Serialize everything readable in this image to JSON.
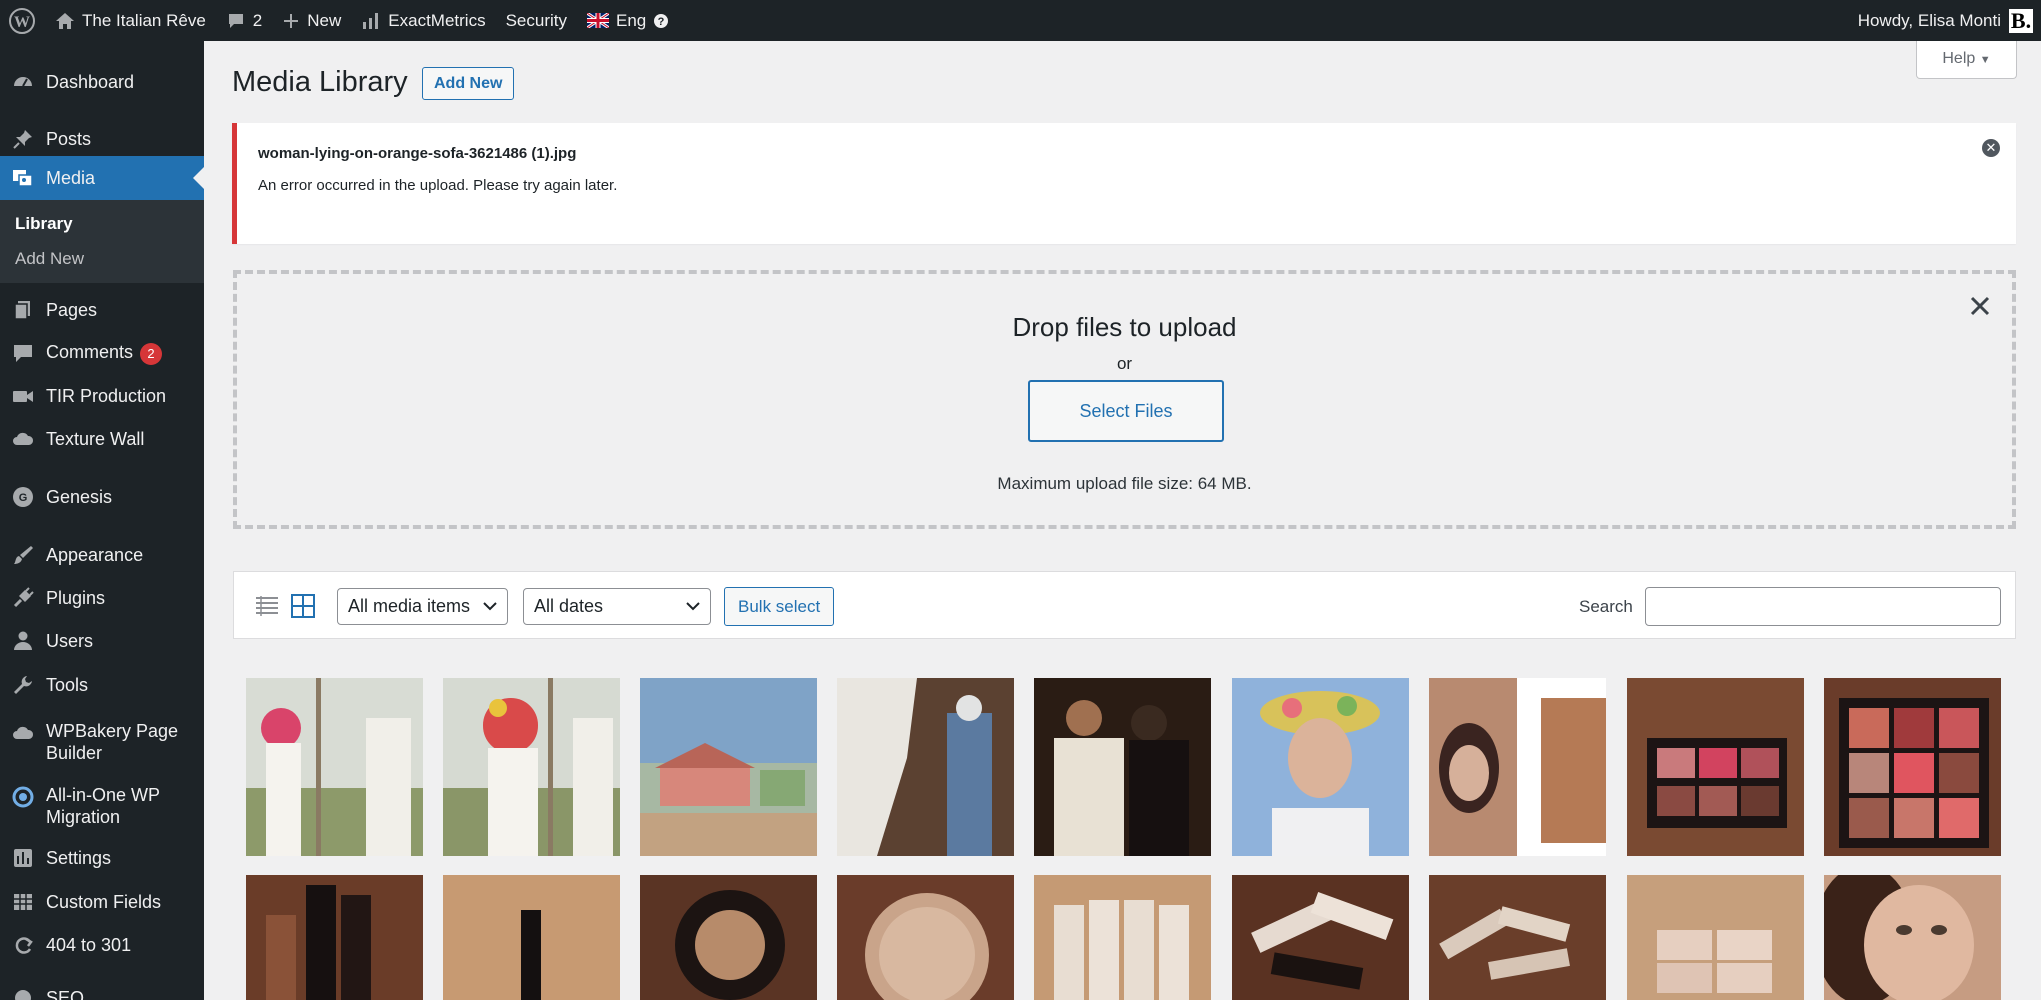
{
  "admin_bar": {
    "site_name": "The Italian Rêve",
    "comments_count": "2",
    "new_label": "New",
    "exactmetrics_label": "ExactMetrics",
    "security_label": "Security",
    "lang_label": "Eng",
    "howdy": "Howdy, Elisa Monti",
    "avatar_letter": "B."
  },
  "sidebar": {
    "items": [
      {
        "label": "Dashboard",
        "icon": "dashboard-icon"
      },
      {
        "label": "Posts",
        "icon": "pin-icon"
      },
      {
        "label": "Media",
        "icon": "media-icon"
      },
      {
        "label": "Pages",
        "icon": "pages-icon"
      },
      {
        "label": "Comments",
        "icon": "comment-icon",
        "badge": "2"
      },
      {
        "label": "TIR Production",
        "icon": "video-icon"
      },
      {
        "label": "Texture Wall",
        "icon": "cloud-icon"
      },
      {
        "label": "Genesis",
        "icon": "genesis-icon"
      },
      {
        "label": "Appearance",
        "icon": "brush-icon"
      },
      {
        "label": "Plugins",
        "icon": "plug-icon"
      },
      {
        "label": "Users",
        "icon": "user-icon"
      },
      {
        "label": "Tools",
        "icon": "wrench-icon"
      },
      {
        "label": "WPBakery Page Builder",
        "icon": "cloud-icon"
      },
      {
        "label": "All-in-One WP Migration",
        "icon": "migration-icon"
      },
      {
        "label": "Settings",
        "icon": "settings-icon"
      },
      {
        "label": "Custom Fields",
        "icon": "table-icon"
      },
      {
        "label": "404 to 301",
        "icon": "redirect-icon"
      },
      {
        "label": "SEO",
        "icon": "seo-icon"
      }
    ],
    "submenu": [
      "Library",
      "Add New"
    ]
  },
  "page": {
    "title": "Media Library",
    "add_new": "Add New",
    "help": "Help"
  },
  "notice": {
    "filename": "woman-lying-on-orange-sofa-3621486 (1).jpg",
    "message": "An error occurred in the upload. Please try again later."
  },
  "uploader": {
    "title": "Drop files to upload",
    "or": "or",
    "button": "Select Files",
    "max_size": "Maximum upload file size: 64 MB."
  },
  "filters": {
    "media_type": "All media items",
    "dates": "All dates",
    "bulk_select": "Bulk select",
    "search_label": "Search",
    "search_value": ""
  },
  "colors": {
    "adminbar": "#1d2327",
    "accent": "#2271b1",
    "error": "#d63638"
  },
  "media_grid": [
    "flower-crown-girls-image",
    "flower-crown-girls-image",
    "pink-house-image",
    "white-horse-guard-image",
    "dancing-couple-image",
    "flower-crown-portrait-image",
    "woman-portrait-collage-image",
    "eyeshadow-palette-image",
    "eyeshadow-palette-image",
    "lipstick-boxes-image",
    "lipstick-tube-image",
    "powder-jar-image",
    "compact-tin-image",
    "halo-tubes-image",
    "halo-tubes-scattered-image",
    "tubes-pile-image",
    "stacked-boxes-image",
    "woman-face-image"
  ]
}
